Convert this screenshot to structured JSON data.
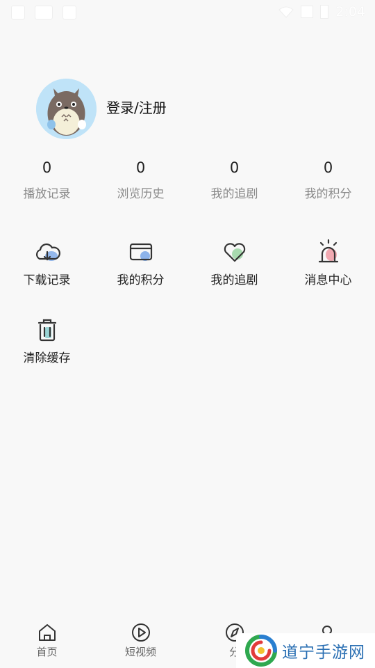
{
  "status_bar": {
    "time": "2:04"
  },
  "profile": {
    "login_label": "登录/注册"
  },
  "stats": [
    {
      "value": "0",
      "label": "播放记录"
    },
    {
      "value": "0",
      "label": "浏览历史"
    },
    {
      "value": "0",
      "label": "我的追剧"
    },
    {
      "value": "0",
      "label": "我的积分"
    }
  ],
  "grid": [
    {
      "label": "下载记录",
      "icon": "cloud-download-icon"
    },
    {
      "label": "我的积分",
      "icon": "wallet-card-icon"
    },
    {
      "label": "我的追剧",
      "icon": "heart-icon"
    },
    {
      "label": "消息中心",
      "icon": "alarm-bell-icon"
    },
    {
      "label": "清除缓存",
      "icon": "trash-icon"
    }
  ],
  "bottom_nav": [
    {
      "label": "首页",
      "icon": "home-icon"
    },
    {
      "label": "短视频",
      "icon": "play-circle-icon"
    },
    {
      "label": "分",
      "icon": "compass-icon"
    },
    {
      "label": "",
      "icon": "search-icon"
    }
  ],
  "watermark": {
    "text": "道宁手游网"
  },
  "colors": {
    "background": "#f8f8f8",
    "accent_blue": "#7aa7e8",
    "accent_green": "#9fd6a6",
    "accent_red": "#f0a0a8"
  }
}
